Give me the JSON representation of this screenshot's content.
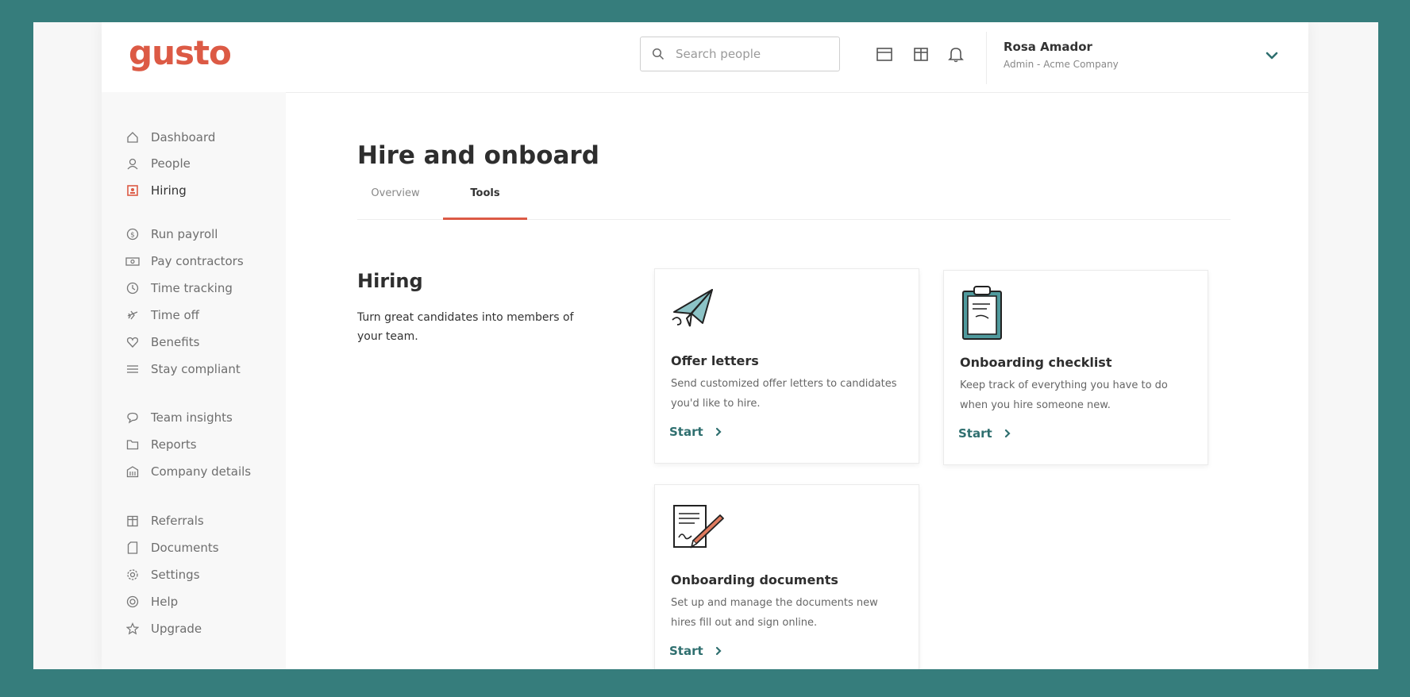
{
  "brand": {
    "logo": "gusto",
    "accent": "#dc5a45",
    "teal": "#2f6f6f",
    "background": "#367d7c"
  },
  "header": {
    "search_placeholder": "Search people",
    "icons": [
      "calendar-icon",
      "gift-icon",
      "bell-icon"
    ],
    "user": {
      "name": "Rosa Amador",
      "role": "Admin - Acme Company"
    }
  },
  "sidebar": {
    "items": [
      {
        "label": "Dashboard",
        "icon": "home-icon"
      },
      {
        "label": "People",
        "icon": "people-icon"
      },
      {
        "label": "Hiring",
        "icon": "hiring-icon",
        "active": true
      },
      {
        "label": "Run payroll",
        "icon": "dollar-icon"
      },
      {
        "label": "Pay contractors",
        "icon": "money-icon"
      },
      {
        "label": "Time tracking",
        "icon": "clock-icon"
      },
      {
        "label": "Time off",
        "icon": "plane-icon"
      },
      {
        "label": "Benefits",
        "icon": "heart-icon"
      },
      {
        "label": "Stay compliant",
        "icon": "list-icon"
      },
      {
        "label": "Team insights",
        "icon": "chat-icon"
      },
      {
        "label": "Reports",
        "icon": "folder-icon"
      },
      {
        "label": "Company details",
        "icon": "building-icon"
      },
      {
        "label": "Referrals",
        "icon": "gift-icon"
      },
      {
        "label": "Documents",
        "icon": "document-icon"
      },
      {
        "label": "Settings",
        "icon": "gear-icon"
      },
      {
        "label": "Help",
        "icon": "help-icon"
      },
      {
        "label": "Upgrade",
        "icon": "star-icon"
      }
    ]
  },
  "main": {
    "title": "Hire and onboard",
    "tabs": [
      {
        "label": "Overview"
      },
      {
        "label": "Tools",
        "active": true
      }
    ],
    "section": {
      "title": "Hiring",
      "description": "Turn great candidates into members of your team."
    },
    "cards": [
      {
        "title": "Offer letters",
        "description": "Send customized offer letters to candidates you'd like to hire.",
        "cta": "Start",
        "icon": "paper-plane-icon"
      },
      {
        "title": "Onboarding checklist",
        "description": "Keep track of everything you have to do when you hire someone new.",
        "cta": "Start",
        "icon": "clipboard-icon"
      },
      {
        "title": "Onboarding documents",
        "description": "Set up and manage the documents new hires fill out and sign online.",
        "cta": "Start",
        "icon": "signed-document-icon"
      }
    ]
  }
}
